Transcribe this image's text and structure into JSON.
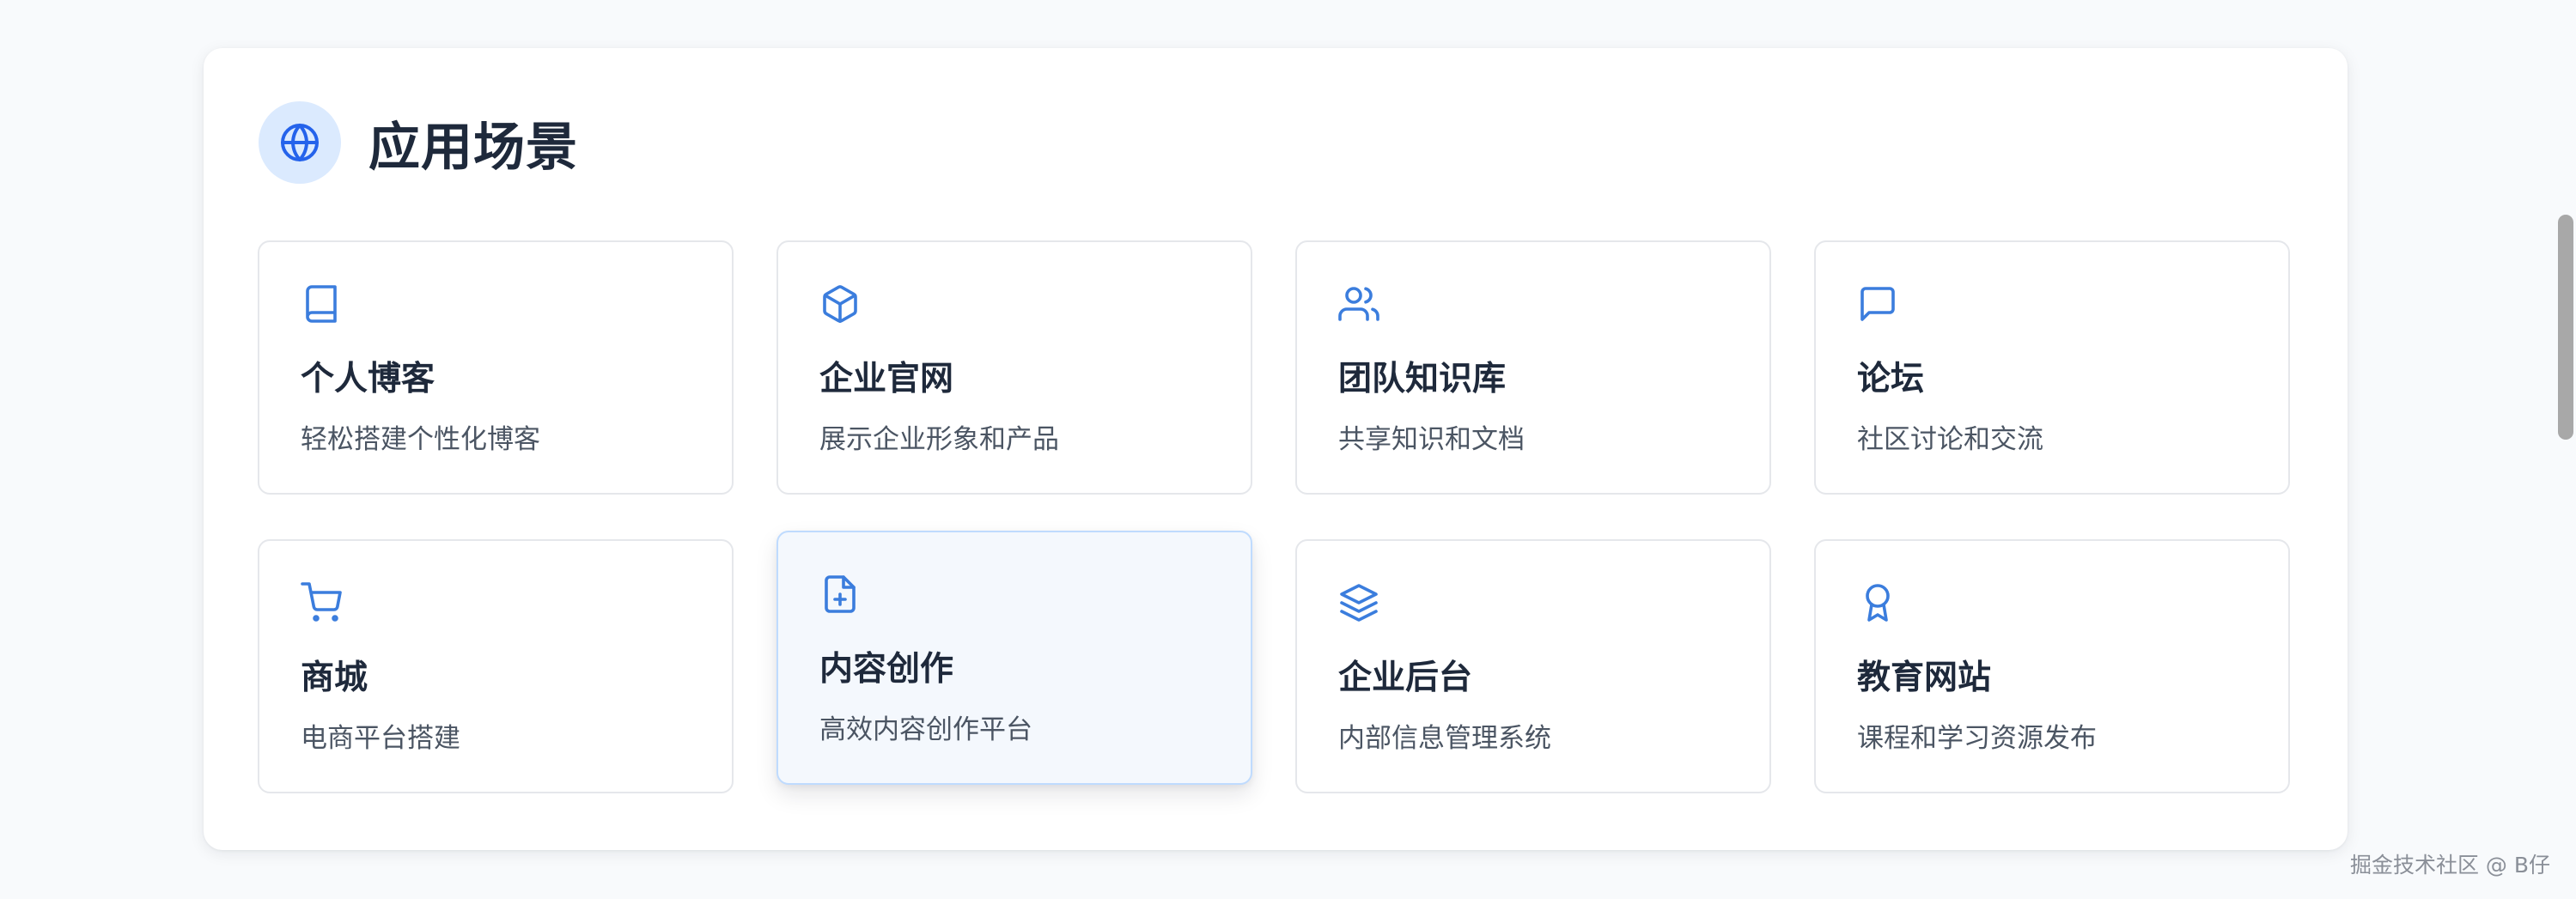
{
  "section": {
    "title": "应用场景",
    "icon": "globe-icon"
  },
  "scenarios": [
    {
      "title": "个人博客",
      "description": "轻松搭建个性化博客",
      "icon": "book-icon"
    },
    {
      "title": "企业官网",
      "description": "展示企业形象和产品",
      "icon": "package-icon"
    },
    {
      "title": "团队知识库",
      "description": "共享知识和文档",
      "icon": "users-icon"
    },
    {
      "title": "论坛",
      "description": "社区讨论和交流",
      "icon": "message-square-icon"
    },
    {
      "title": "商城",
      "description": "电商平台搭建",
      "icon": "shopping-cart-icon"
    },
    {
      "title": "内容创作",
      "description": "高效内容创作平台",
      "icon": "file-plus-icon",
      "state": "hovered"
    },
    {
      "title": "企业后台",
      "description": "内部信息管理系统",
      "icon": "layers-icon"
    },
    {
      "title": "教育网站",
      "description": "课程和学习资源发布",
      "icon": "award-icon"
    }
  ],
  "watermark": "掘金技术社区 @ B仔",
  "colors": {
    "accent": "#3b7ddd",
    "icon_bg": "#dbeafe",
    "title_text": "#1e293b",
    "body_text": "#4b5563",
    "card_border": "#e5e7eb",
    "hover_bg": "#f4f8fd",
    "hover_border": "#bfdbfe",
    "page_bg": "#f8fafc"
  }
}
